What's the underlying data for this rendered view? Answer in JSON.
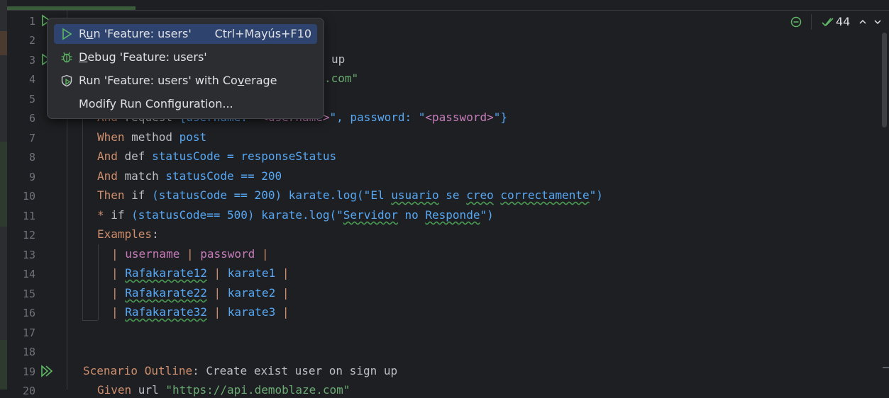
{
  "editor": {
    "line_numbers": [
      "1",
      "2",
      "3",
      "4",
      "5",
      "6",
      "7",
      "8",
      "9",
      "10",
      "11",
      "12",
      "13",
      "14",
      "15",
      "16",
      "17",
      "18",
      "19",
      "20"
    ],
    "lines": {
      "l3_tail": "up",
      "l4_tail": ".com\"",
      "l6_and": "And",
      "l6_request": " request ",
      "l6_brace": "{username: \"",
      "l6_user": "<username>",
      "l6_mid": "\", password: \"",
      "l6_pass": "<password>",
      "l6_end": "\"}",
      "l7_kw": "When",
      "l7_a": " method ",
      "l7_b": "post",
      "l8_kw": "And",
      "l8_a": " def ",
      "l8_b": "statusCode",
      "l8_c": " = ",
      "l8_d": "responseStatus",
      "l9_kw": "And",
      "l9_a": " match ",
      "l9_b": "statusCode == 200",
      "l10_kw": "Then",
      "l10_a": " if ",
      "l10_b": "(statusCode == 200) karate.log(\"El ",
      "l10_u1": "usuario",
      "l10_s1": " se ",
      "l10_u2": "creo",
      "l10_s2": " ",
      "l10_u3": "correctamente",
      "l10_end": "\")",
      "l11_kw": "*",
      "l11_a": " if ",
      "l11_b": "(statusCode== 500) karate.log(\"",
      "l11_u1": "Servidor",
      "l11_s1": " no ",
      "l11_u2": "Responde",
      "l11_end": "\")",
      "l12_kw": "Examples",
      "l12_colon": ":",
      "l13_a": "| ",
      "l13_b": "username",
      "l13_c": " | ",
      "l13_d": "password",
      "l13_e": " |",
      "l14_a": "| ",
      "l14_b": "Rafakarate12",
      "l14_c": " | ",
      "l14_d": "karate1",
      "l14_e": " |",
      "l15_a": "| ",
      "l15_b": "Rafakarate22",
      "l15_c": " | ",
      "l15_d": "karate2",
      "l15_e": " |",
      "l16_a": "| ",
      "l16_b": "Rafakarate32",
      "l16_c": " | ",
      "l16_d": "karate3",
      "l16_e": " |",
      "l19_kw": "Scenario Outline",
      "l19_rest": ": Create exist user on sign up",
      "l20_kw": "Given",
      "l20_a": " url ",
      "l20_b": "\"https://api.demoblaze.com\""
    }
  },
  "status": {
    "checks_count": "44"
  },
  "context_menu": {
    "items": [
      {
        "label_pre": "R",
        "label_mn": "u",
        "label_post": "n 'Feature: users'",
        "shortcut": "Ctrl+Mayús+F10",
        "icon": "run-icon"
      },
      {
        "label_pre": "",
        "label_mn": "D",
        "label_post": "ebug 'Feature: users'",
        "shortcut": "",
        "icon": "debug-icon"
      },
      {
        "label_pre": "Run 'Feature: users' with Co",
        "label_mn": "v",
        "label_post": "erage",
        "shortcut": "",
        "icon": "coverage-icon"
      },
      {
        "label_pre": "Modify Run Configuration...",
        "label_mn": "",
        "label_post": "",
        "shortcut": "",
        "icon": ""
      }
    ]
  },
  "colors": {
    "background": "#1e1f22",
    "keyword": "#cf8e6d",
    "string": "#6aab73",
    "accent_blue": "#56a8f5",
    "selection": "#2e436e"
  }
}
